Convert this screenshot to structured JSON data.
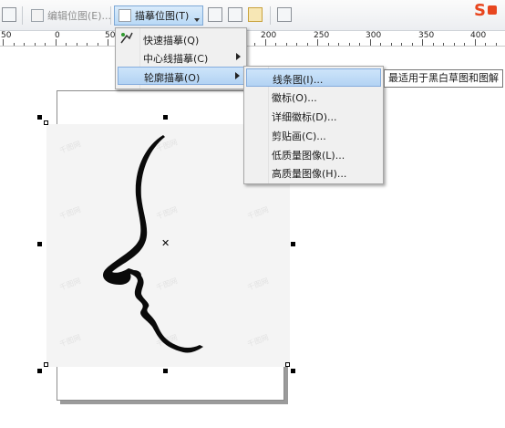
{
  "toolbar": {
    "edit_bitmap_label": "编辑位图(E)...",
    "trace_bitmap_label": "描摹位图(T)",
    "brand_logo_text": "S"
  },
  "ruler": {
    "labels": [
      "50",
      "0",
      "50",
      "200",
      "250",
      "300",
      "350",
      "400"
    ]
  },
  "trace_menu": {
    "items": [
      {
        "label": "快速描摹(Q)",
        "icon": "quick-trace-icon"
      },
      {
        "label": "中心线描摹(C)",
        "submenu": true
      },
      {
        "label": "轮廓描摹(O)",
        "submenu": true,
        "highlighted": true
      }
    ]
  },
  "outline_submenu": {
    "items": [
      {
        "label": "线条图(I)...",
        "highlighted": true
      },
      {
        "label": "徽标(O)..."
      },
      {
        "label": "详细徽标(D)..."
      },
      {
        "label": "剪贴画(C)..."
      },
      {
        "label": "低质量图像(L)..."
      },
      {
        "label": "高质量图像(H)..."
      }
    ]
  },
  "tooltip": {
    "text": "最适用于黑白草图和图解"
  },
  "canvas": {
    "watermark_text": "千图网"
  },
  "colors": {
    "menu_highlight": "#b3d3f3",
    "toolbar_active": "#b9d9f6",
    "brand": "#e8461f"
  }
}
